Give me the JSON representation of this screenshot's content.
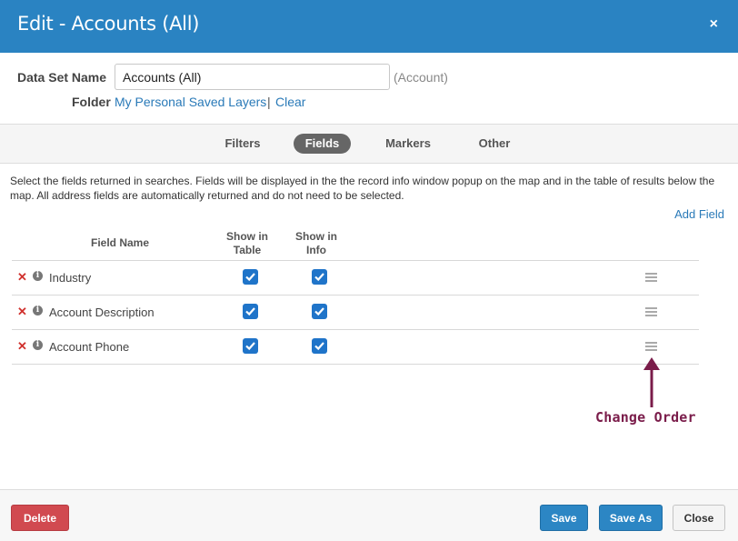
{
  "header": {
    "title": "Edit - Accounts (All)",
    "close_icon": "×"
  },
  "dataset": {
    "name_label": "Data Set Name",
    "name_value": "Accounts (All)",
    "object_type": "(Account)",
    "folder_label": "Folder",
    "folder_link": "My Personal Saved Layers",
    "separator": "|",
    "clear_link": "Clear"
  },
  "tabs": [
    {
      "label": "Filters",
      "active": false
    },
    {
      "label": "Fields",
      "active": true
    },
    {
      "label": "Markers",
      "active": false
    },
    {
      "label": "Other",
      "active": false
    }
  ],
  "description": "Select the fields returned in searches. Fields will be displayed in the the record info window popup on the map and in the table of results below the map. All address fields are automatically returned and do not need to be selected.",
  "add_field": "Add Field",
  "table": {
    "headers": {
      "field_name": "Field Name",
      "show_in_table": "Show in Table",
      "show_in_info": "Show in Info"
    },
    "rows": [
      {
        "name": "Industry",
        "show_in_table": true,
        "show_in_info": true
      },
      {
        "name": "Account Description",
        "show_in_table": true,
        "show_in_info": true
      },
      {
        "name": "Account Phone",
        "show_in_table": true,
        "show_in_info": true
      }
    ]
  },
  "annotation": {
    "text": "Change Order",
    "color": "#7a1c4a"
  },
  "footer": {
    "delete": "Delete",
    "save": "Save",
    "save_as": "Save As",
    "close": "Close"
  },
  "colors": {
    "header_bg": "#2a83c2",
    "link": "#2a7ab8",
    "delete_btn": "#d14a50",
    "primary_btn": "#2c86c4",
    "checkbox": "#1f74c9"
  },
  "icons": {
    "remove": "close-x-icon",
    "info": "info-circle-icon",
    "checkbox": "checkbox-checked-icon",
    "drag": "drag-handle-icon"
  }
}
